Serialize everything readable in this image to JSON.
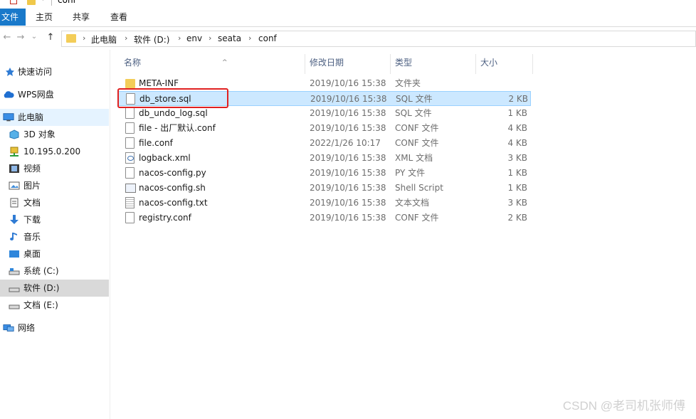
{
  "window": {
    "title": "conf"
  },
  "ribbon": {
    "tabs": [
      "文件",
      "主页",
      "共享",
      "查看"
    ]
  },
  "nav": {
    "back": "←",
    "forward": "→",
    "recent": "⌄",
    "up": "↑",
    "breadcrumb": [
      "此电脑",
      "软件 (D:)",
      "env",
      "seata",
      "conf"
    ],
    "separator": "›"
  },
  "sidebar": {
    "items": [
      {
        "label": "快速访问",
        "icon": "pin-icon"
      },
      {
        "label": "WPS网盘",
        "icon": "cloud-icon"
      },
      {
        "label": "此电脑",
        "icon": "computer-icon"
      },
      {
        "label": "3D 对象",
        "icon": "cube-icon"
      },
      {
        "label": "10.195.0.200",
        "icon": "network-drive-icon"
      },
      {
        "label": "视频",
        "icon": "video-icon"
      },
      {
        "label": "图片",
        "icon": "picture-icon"
      },
      {
        "label": "文档",
        "icon": "document-icon"
      },
      {
        "label": "下载",
        "icon": "download-icon"
      },
      {
        "label": "音乐",
        "icon": "music-icon"
      },
      {
        "label": "桌面",
        "icon": "desktop-icon"
      },
      {
        "label": "系统 (C:)",
        "icon": "drive-icon"
      },
      {
        "label": "软件 (D:)",
        "icon": "drive-icon"
      },
      {
        "label": "文档 (E:)",
        "icon": "drive-icon"
      },
      {
        "label": "网络",
        "icon": "network-icon"
      }
    ]
  },
  "columns": {
    "name": "名称",
    "date": "修改日期",
    "type": "类型",
    "size": "大小"
  },
  "files": [
    {
      "name": "META-INF",
      "date": "2019/10/16 15:38",
      "type": "文件夹",
      "size": "",
      "icon": "folder-icon"
    },
    {
      "name": "db_store.sql",
      "date": "2019/10/16 15:38",
      "type": "SQL 文件",
      "size": "2 KB",
      "icon": "file-icon"
    },
    {
      "name": "db_undo_log.sql",
      "date": "2019/10/16 15:38",
      "type": "SQL 文件",
      "size": "1 KB",
      "icon": "file-icon"
    },
    {
      "name": "file - 出厂默认.conf",
      "date": "2019/10/16 15:38",
      "type": "CONF 文件",
      "size": "4 KB",
      "icon": "file-icon"
    },
    {
      "name": "file.conf",
      "date": "2022/1/26 10:17",
      "type": "CONF 文件",
      "size": "4 KB",
      "icon": "file-icon"
    },
    {
      "name": "logback.xml",
      "date": "2019/10/16 15:38",
      "type": "XML 文档",
      "size": "3 KB",
      "icon": "xml-file-icon"
    },
    {
      "name": "nacos-config.py",
      "date": "2019/10/16 15:38",
      "type": "PY 文件",
      "size": "1 KB",
      "icon": "file-icon"
    },
    {
      "name": "nacos-config.sh",
      "date": "2019/10/16 15:38",
      "type": "Shell Script",
      "size": "1 KB",
      "icon": "shell-script-icon"
    },
    {
      "name": "nacos-config.txt",
      "date": "2019/10/16 15:38",
      "type": "文本文档",
      "size": "3 KB",
      "icon": "text-file-icon"
    },
    {
      "name": "registry.conf",
      "date": "2019/10/16 15:38",
      "type": "CONF 文件",
      "size": "2 KB",
      "icon": "file-icon"
    }
  ],
  "watermark": "CSDN @老司机张师傅",
  "colors": {
    "file_tab": "#1979ca",
    "selection": "#cce8ff",
    "highlight_box": "#e02020"
  }
}
